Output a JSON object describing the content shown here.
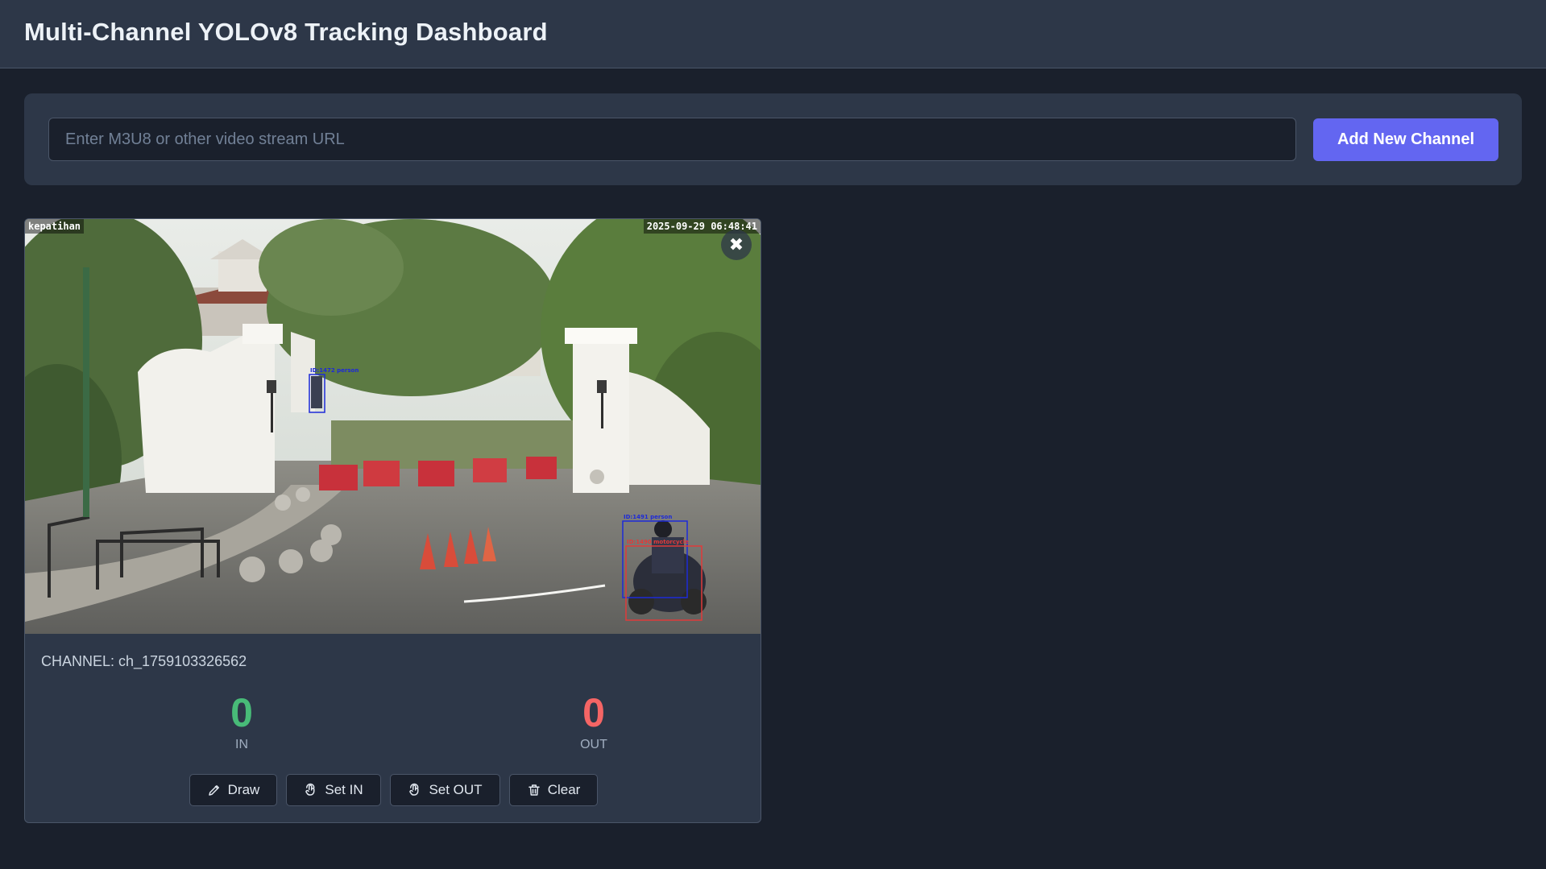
{
  "header": {
    "title": "Multi-Channel YOLOv8 Tracking Dashboard"
  },
  "stream_form": {
    "url_placeholder": "Enter M3U8 or other video stream URL",
    "url_value": "",
    "add_button_label": "Add New Channel"
  },
  "channel": {
    "name_text": "CHANNEL: ch_1759103326562",
    "overlay": {
      "camera_name": "kepatihan",
      "timestamp": "2025-09-29 06:48:41",
      "detections": [
        "ID:1472 person",
        "ID:1491 person",
        "ID:1490 motorcycle"
      ]
    },
    "close_glyph": "✖",
    "counters": {
      "in": {
        "value": "0",
        "label": "IN"
      },
      "out": {
        "value": "0",
        "label": "OUT"
      }
    },
    "controls": {
      "draw": "Draw",
      "set_in": "Set IN",
      "set_out": "Set OUT",
      "clear": "Clear"
    }
  },
  "colors": {
    "page_bg": "#1a202c",
    "panel_bg": "#2d3748",
    "accent": "#6366f1",
    "in_color": "#48bb78",
    "out_color": "#f56565"
  },
  "icons": [
    "close-icon",
    "pencil-icon",
    "touch-point-icon",
    "trash-icon"
  ]
}
